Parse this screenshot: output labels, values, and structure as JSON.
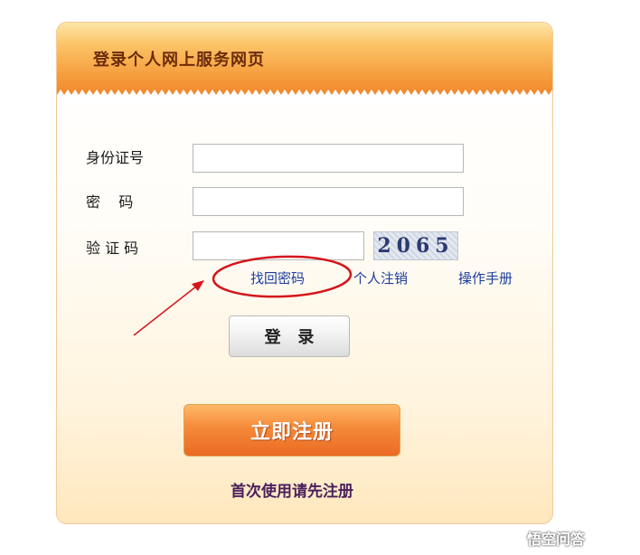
{
  "panel": {
    "title": "登录个人网上服务网页"
  },
  "form": {
    "id_label": "身份证号",
    "id_value": "",
    "password_label": "密    码",
    "password_value": "",
    "captcha_label": "验 证 码",
    "captcha_value": "",
    "captcha_code": "2065"
  },
  "links": {
    "retrieve_password": "找回密码",
    "cancel_account": "个人注销",
    "manual": "操作手册"
  },
  "buttons": {
    "login_label": "登   录",
    "register_label": "立即注册"
  },
  "register_hint": "首次使用请先注册",
  "watermark": {
    "text": "悟空问答",
    "icon": "wukong-logo-icon"
  },
  "colors": {
    "header_orange": "#f59a3a",
    "link_blue": "#1c3c9e",
    "annotation_red": "#d4161c",
    "register_orange": "#f58a38"
  }
}
